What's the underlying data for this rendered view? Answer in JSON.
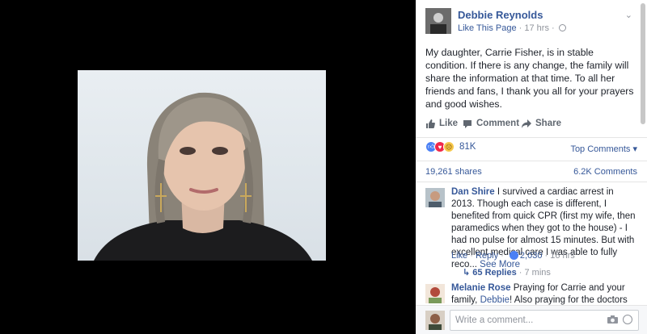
{
  "post": {
    "page_name": "Debbie Reynolds",
    "like_page": "Like This Page",
    "separator": "·",
    "time": "17 hrs",
    "text": "My daughter, Carrie Fisher, is in stable condition. If there is any change, the family will share the information at that time. To all her friends and fans, I thank you all for your prayers and good wishes."
  },
  "actions": {
    "like": "Like",
    "comment": "Comment",
    "share": "Share"
  },
  "reactions": {
    "count": "81K",
    "top_comments": "Top Comments ▾"
  },
  "counts": {
    "shares": "19,261 shares",
    "comments": "6.2K Comments"
  },
  "comments": [
    {
      "name": "Dan Shire",
      "text": "I survived a cardiac arrest in 2013. Though each case is different, I benefited from quick CPR (first my wife, then paramedics when they got to the house) - I had no pulse for almost 15 minutes. But with excellent medical care I was able to fully reco...",
      "see_more": "See More",
      "like": "Like",
      "reply": "Reply",
      "dot": "·",
      "likes": "2,030",
      "time": "16 hrs",
      "replies": "65 Replies",
      "replies_time": "7 mins"
    },
    {
      "name": "Melanie Rose",
      "text_a": "Praying for Carrie and your family,",
      "mention": "Debbie",
      "text_b": "! Also praying for the doctors and nurses"
    }
  ],
  "composer": {
    "placeholder": "Write a comment..."
  },
  "icons": {
    "like": "thumbs-up-icon",
    "comment": "speech-bubble-icon",
    "share": "share-arrow-icon",
    "camera": "camera-icon",
    "emoji": "smiley-icon",
    "globe": "globe-icon",
    "chevron": "chevron-down-icon",
    "reply_arrow": "reply-arrow-icon"
  },
  "colors": {
    "link": "#365899",
    "muted": "#90949c",
    "like_blue": "#4a80f5",
    "love_red": "#f0284a"
  }
}
